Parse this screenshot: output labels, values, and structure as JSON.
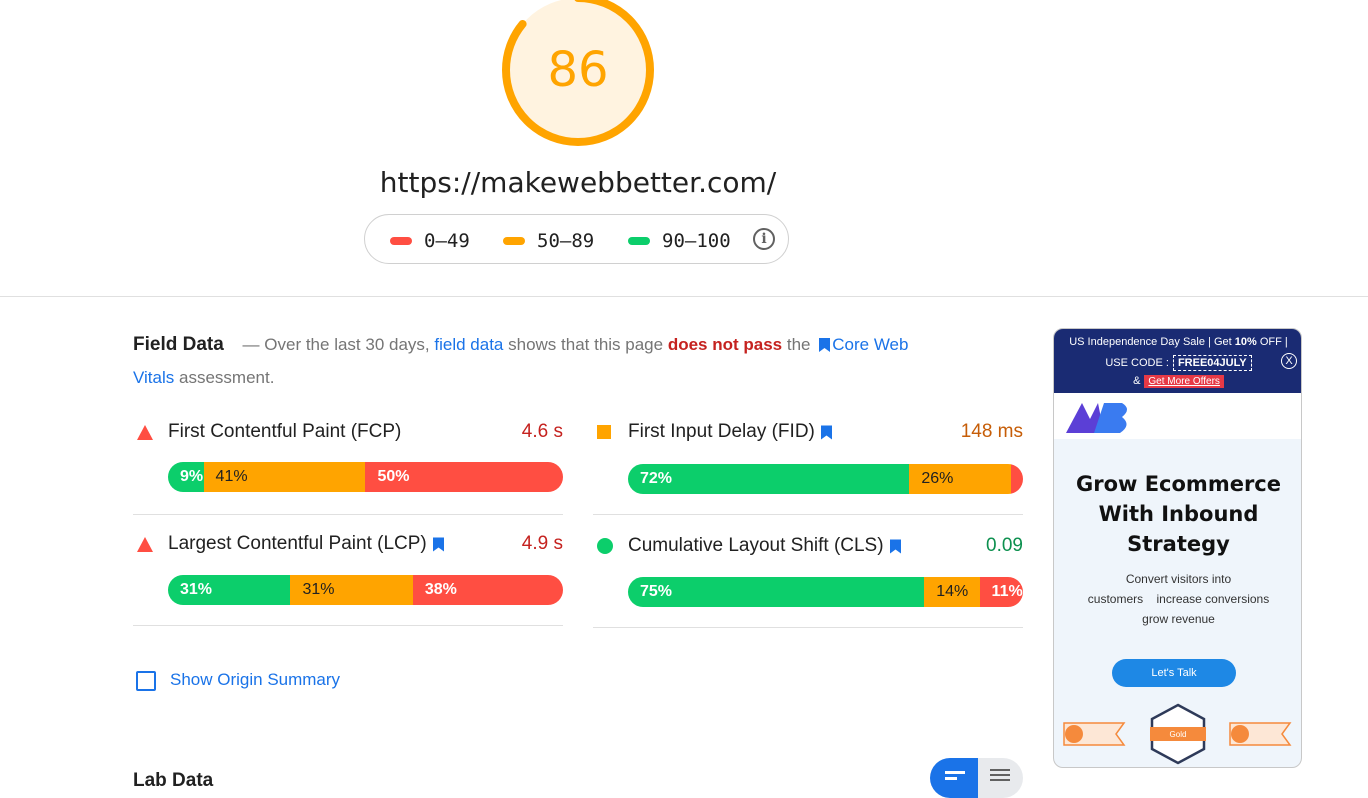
{
  "score": {
    "value": "86",
    "color": "#ffa400",
    "fraction": 0.86
  },
  "url": "https://makewebbetter.com/",
  "legend": {
    "items": [
      {
        "label": "0–49",
        "color": "#ff4e42"
      },
      {
        "label": "50–89",
        "color": "#ffa400"
      },
      {
        "label": "90–100",
        "color": "#0cce6b"
      }
    ],
    "info_icon": "info-icon"
  },
  "field_data": {
    "title": "Field Data",
    "desc_dash": "— Over the last 30 days,",
    "link_field": "field data",
    "desc_mid": "shows that this page",
    "fail_text": "does not pass",
    "desc_the": "the",
    "link_cwv": "Core Web Vitals",
    "desc_end": "assessment."
  },
  "metrics": {
    "fcp": {
      "name": "First Contentful Paint (FCP)",
      "value": "4.6 s",
      "status": "fail",
      "bookmark": false,
      "dist": [
        "9%",
        "41%",
        "50%"
      ],
      "fractions": [
        0.09,
        0.41,
        0.5
      ]
    },
    "fid": {
      "name": "First Input Delay (FID)",
      "value": "148 ms",
      "status": "average",
      "bookmark": true,
      "dist": [
        "72%",
        "26%",
        "2%"
      ],
      "fractions": [
        0.72,
        0.26,
        0.02
      ]
    },
    "lcp": {
      "name": "Largest Contentful Paint (LCP)",
      "value": "4.9 s",
      "status": "fail",
      "bookmark": true,
      "dist": [
        "31%",
        "31%",
        "38%"
      ],
      "fractions": [
        0.31,
        0.31,
        0.38
      ]
    },
    "cls": {
      "name": "Cumulative Layout Shift (CLS)",
      "value": "0.09",
      "status": "pass",
      "bookmark": true,
      "dist": [
        "75%",
        "14%",
        "11%"
      ],
      "fractions": [
        0.75,
        0.14,
        0.11
      ]
    }
  },
  "origin_summary": {
    "label": "Show Origin Summary",
    "checked": false
  },
  "lab_data": {
    "title": "Lab Data"
  },
  "ad": {
    "line1_pre": "US Independence Day Sale | Get",
    "line1_bold": "10%",
    "line1_post": "OFF |",
    "code_label": "USE CODE :",
    "code": "FREE04JULY",
    "amp": "&",
    "offer_btn": "Get More Offers",
    "close": "X",
    "headline": [
      "Grow Ecommerce",
      "With Inbound",
      "Strategy"
    ],
    "sub": [
      "Convert visitors into",
      "customers    increase conversions",
      "grow revenue"
    ],
    "cta": "Let's Talk",
    "badge_center": "Gold"
  },
  "colors": {
    "pass": "#0cce6b",
    "average": "#ffa400",
    "fail": "#ff4e42",
    "link": "#1a73e8",
    "fail_text": "#c5221f"
  }
}
